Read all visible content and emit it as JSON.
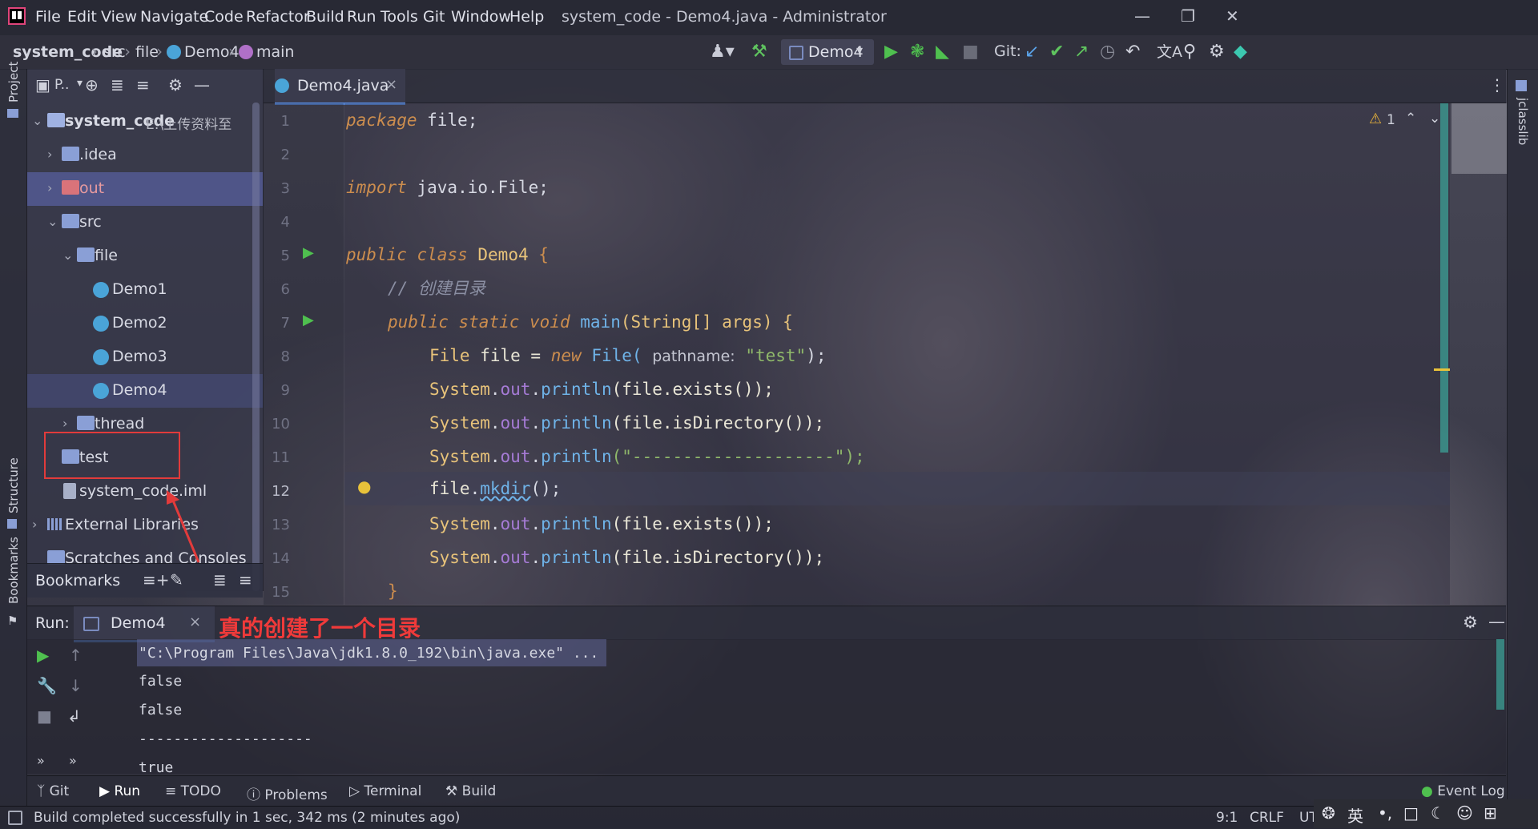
{
  "window": {
    "title": "system_code - Demo4.java - Administrator"
  },
  "menu": [
    "File",
    "Edit",
    "View",
    "Navigate",
    "Code",
    "Refactor",
    "Build",
    "Run",
    "Tools",
    "Git",
    "Window",
    "Help"
  ],
  "breadcrumb": {
    "project": "system_code",
    "src": "src",
    "pkg": "file",
    "cls": "Demo4",
    "method": "main"
  },
  "toolbar": {
    "run_config": "Demo4",
    "git_label": "Git:"
  },
  "project_panel": {
    "title": "P..",
    "root": {
      "name": "system_code",
      "path": "E:\\上传资料至"
    },
    "items": [
      {
        "label": ".idea"
      },
      {
        "label": "out"
      },
      {
        "label": "src"
      },
      {
        "label": "file"
      },
      {
        "label": "Demo1"
      },
      {
        "label": "Demo2"
      },
      {
        "label": "Demo3"
      },
      {
        "label": "Demo4"
      },
      {
        "label": "thread"
      },
      {
        "label": "test"
      },
      {
        "label": "system_code.iml"
      },
      {
        "label": "External Libraries"
      },
      {
        "label": "Scratches and Consoles"
      }
    ],
    "bookmarks_label": "Bookmarks"
  },
  "left_stripe": {
    "project": "Project",
    "structure": "Structure",
    "bookmarks": "Bookmarks"
  },
  "right_stripe": {
    "jclasslib": "jclasslib"
  },
  "editor": {
    "tab_label": "Demo4.java",
    "warning_count": "1",
    "line_numbers": [
      "1",
      "2",
      "3",
      "4",
      "5",
      "6",
      "7",
      "8",
      "9",
      "10",
      "11",
      "12",
      "13",
      "14",
      "15"
    ],
    "current_line": 12,
    "tokens": {
      "package_kw": "package",
      "package_name": " file;",
      "import_kw": "import",
      "import_name": " java.io.File;",
      "public": "public",
      "class": "class",
      "class_name": "Demo4",
      "brace_open": " {",
      "comment": "// 创建目录",
      "static": "static",
      "void": "void",
      "main": "main",
      "main_sig": "(String[] args) {",
      "file_type": "File",
      "file_var": " file = ",
      "new_kw": "new",
      "file_ctor": " File(",
      "param_hint": "pathname:",
      "test_str": "\"test\"",
      "close_stmt": ");",
      "system": "System",
      "dot": ".",
      "out": "out",
      "println": "println",
      "exists_call": "(file.exists());",
      "isdir_call": "(file.isDirectory());",
      "dash_str": "(\"--------------------\");",
      "file_obj": "file",
      "mkdir": "mkdir",
      "mkdir_tail": "();",
      "close_brace": "}"
    }
  },
  "annotation": {
    "text": "真的创建了一个目录"
  },
  "run_panel": {
    "label": "Run:",
    "tab": "Demo4",
    "lines": [
      "\"C:\\Program Files\\Java\\jdk1.8.0_192\\bin\\java.exe\" ...",
      "false",
      "false",
      "--------------------",
      "true"
    ]
  },
  "bottom_tools": [
    "Git",
    "Run",
    "TODO",
    "Problems",
    "Terminal",
    "Build"
  ],
  "event_log": "Event Log",
  "status": {
    "message": "Build completed successfully in 1 sec, 342 ms (2 minutes ago)",
    "position": "9:1",
    "line_sep": "CRLF",
    "encoding": "UT"
  },
  "ime": {
    "lang": "英"
  }
}
